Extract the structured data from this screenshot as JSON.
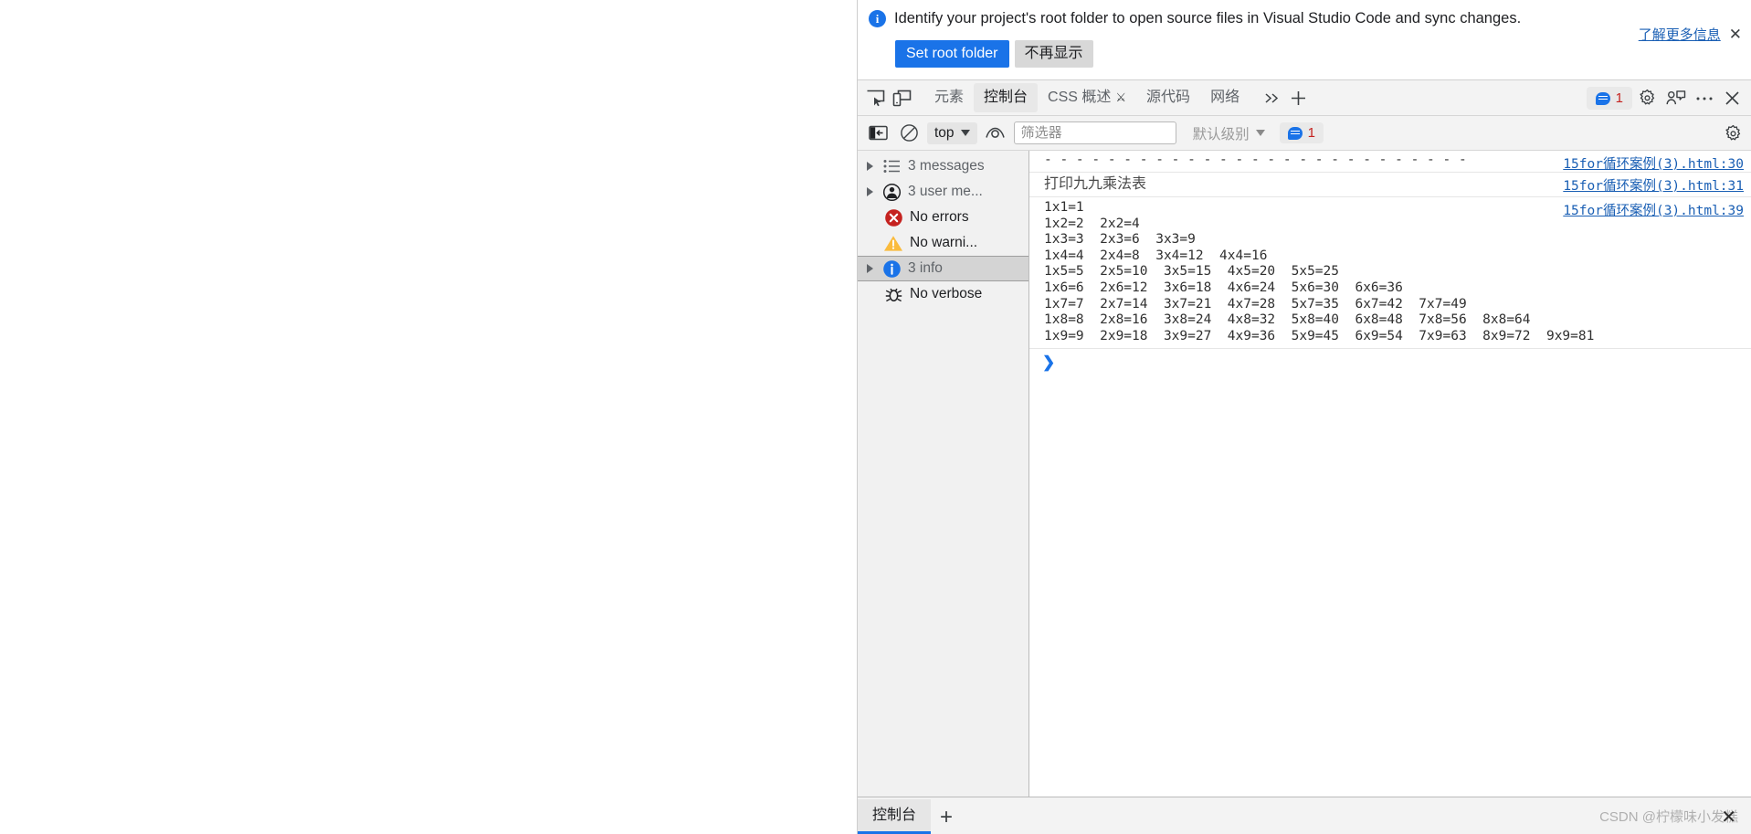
{
  "infobar": {
    "icon": "info-circle-icon",
    "message": "Identify your project's root folder to open source files in Visual Studio Code and sync changes.",
    "primary_button": "Set root folder",
    "secondary_button": "不再显示",
    "learn_more": "了解更多信息",
    "close": "✕"
  },
  "tabbar": {
    "icons": [
      "inspect-element-icon",
      "device-toolbar-icon"
    ],
    "tabs": [
      {
        "label": "元素",
        "active": false,
        "beaker": false
      },
      {
        "label": "控制台",
        "active": true,
        "beaker": false
      },
      {
        "label": "CSS 概述",
        "active": false,
        "beaker": true
      },
      {
        "label": "源代码",
        "active": false,
        "beaker": false
      },
      {
        "label": "网络",
        "active": false,
        "beaker": false
      }
    ],
    "more_tabs": "»",
    "add_tab": "+",
    "issues_count": "1",
    "right_icons": [
      "settings-gear-icon",
      "feedback-icon",
      "more-options-icon",
      "close-devtools-icon"
    ]
  },
  "console_toolbar": {
    "sidebar_toggle": "console-sidebar-toggle-icon",
    "clear_console": "clear-console-icon",
    "context_label": "top",
    "live_expression": "eye-icon",
    "filter_placeholder": "筛选器",
    "filter_value": "",
    "level_label": "默认级别",
    "issues_count": "1",
    "settings": "settings-gear-icon"
  },
  "sidebar": {
    "items": [
      {
        "label": "3 messages",
        "icon": "list-icon",
        "expandable": true,
        "selected": false,
        "dark": false
      },
      {
        "label": "3 user me...",
        "icon": "user-icon",
        "expandable": true,
        "selected": false,
        "dark": false
      },
      {
        "label": "No errors",
        "icon": "error-icon",
        "expandable": false,
        "selected": false,
        "dark": true
      },
      {
        "label": "No warni...",
        "icon": "warning-icon",
        "expandable": false,
        "selected": false,
        "dark": true
      },
      {
        "label": "3 info",
        "icon": "info-icon",
        "expandable": true,
        "selected": true,
        "dark": false
      },
      {
        "label": "No verbose",
        "icon": "bug-icon",
        "expandable": false,
        "selected": false,
        "dark": true
      }
    ]
  },
  "console_messages": [
    {
      "text": "- - - - - - - - - - - - - - - - - - - - - - - - - - -",
      "style": "mono",
      "source": "15for循环案例(3).html:30"
    },
    {
      "text": "打印九九乘法表",
      "style": "cjk",
      "source": "15for循环案例(3).html:31"
    },
    {
      "text": "1x1=1\n1x2=2  2x2=4\n1x3=3  2x3=6  3x3=9\n1x4=4  2x4=8  3x4=12  4x4=16\n1x5=5  2x5=10  3x5=15  4x5=20  5x5=25\n1x6=6  2x6=12  3x6=18  4x6=24  5x6=30  6x6=36\n1x7=7  2x7=14  3x7=21  4x7=28  5x7=35  6x7=42  7x7=49\n1x8=8  2x8=16  3x8=24  4x8=32  5x8=40  6x8=48  7x8=56  8x8=64\n1x9=9  2x9=18  3x9=27  4x9=36  5x9=45  6x9=54  7x9=63  8x9=72  9x9=81",
      "style": "mono",
      "source": "15for循环案例(3).html:39"
    }
  ],
  "prompt": {
    "arrow": "❯",
    "value": ""
  },
  "drawer": {
    "tab_label": "控制台",
    "add_label": "+",
    "close_label": "✕"
  },
  "watermark": "CSDN @柠檬味小发糕"
}
